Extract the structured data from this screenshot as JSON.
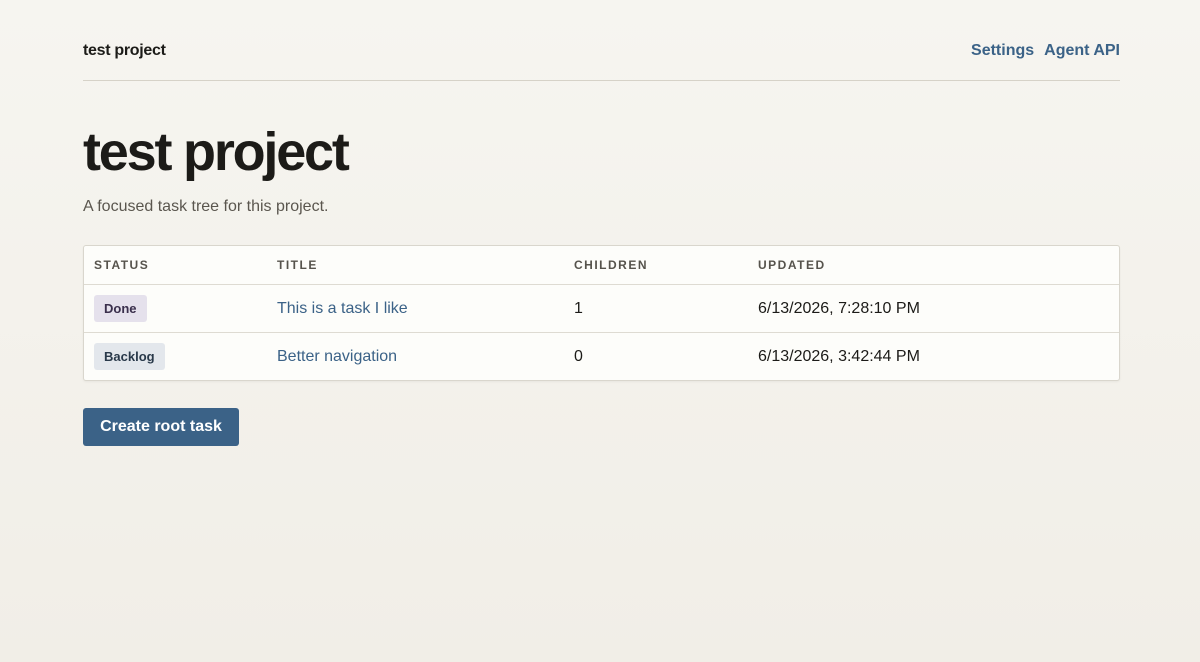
{
  "header": {
    "brand": "test project",
    "nav": [
      "Settings",
      "Agent API"
    ]
  },
  "main": {
    "title": "test project",
    "subtitle": "A focused task tree for this project.",
    "table": {
      "columns": [
        "STATUS",
        "TITLE",
        "CHILDREN",
        "UPDATED"
      ],
      "rows": [
        {
          "status": "Done",
          "title": "This is a task I like",
          "children": "1",
          "updated": "6/13/2026, 7:28:10 PM"
        },
        {
          "status": "Backlog",
          "title": "Better navigation",
          "children": "0",
          "updated": "6/13/2026, 3:42:44 PM"
        }
      ]
    },
    "create_button": "Create root task"
  },
  "colors": {
    "accent": "#3b6287",
    "done_badge_bg": "#e5e1ec",
    "backlog_badge_bg": "#e3e7ec"
  }
}
